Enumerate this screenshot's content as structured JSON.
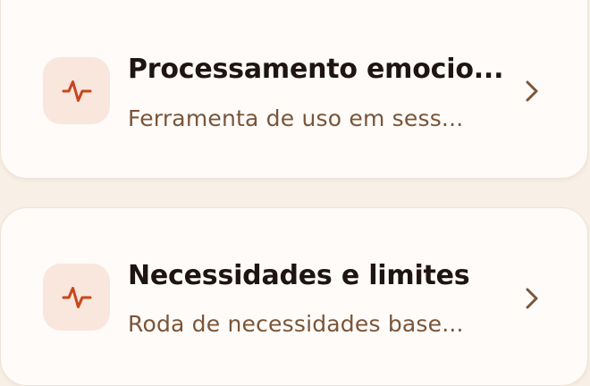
{
  "colors": {
    "background": "#f8efe6",
    "card": "#fefbf9",
    "icon_tile": "#f9e6dd",
    "icon_stroke": "#c8461c",
    "title": "#1e1512",
    "subtitle": "#7a5538",
    "chevron": "#7a5538"
  },
  "items": [
    {
      "title": "Processamento emocio...",
      "subtitle": "Ferramenta de uso em sess...",
      "icon": "activity-pulse-icon"
    },
    {
      "title": "Necessidades e limites",
      "subtitle": "Roda de necessidades base...",
      "icon": "activity-pulse-icon"
    }
  ]
}
